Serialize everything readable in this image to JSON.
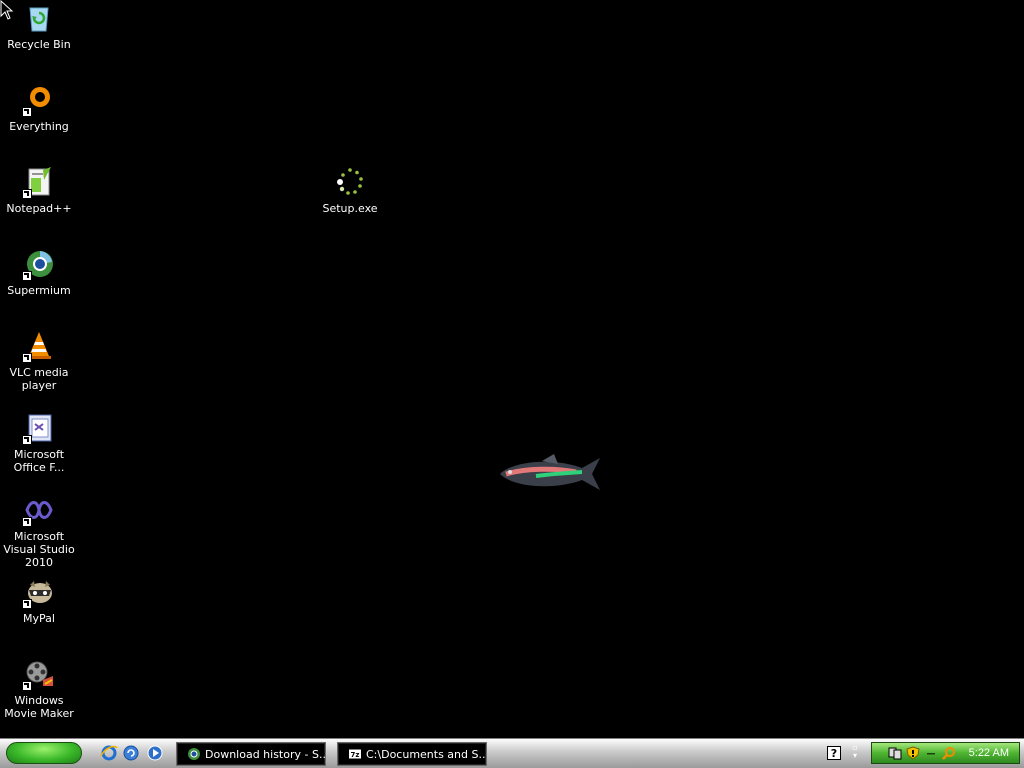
{
  "desktop": {
    "icons": [
      {
        "label": "Recycle Bin",
        "icon": "recycle-bin-icon",
        "shortcut": false
      },
      {
        "label": "Everything",
        "icon": "everything-search-icon",
        "shortcut": true
      },
      {
        "label": "Notepad++",
        "icon": "notepad-plus-plus-icon",
        "shortcut": true
      },
      {
        "label": "Supermium",
        "icon": "supermium-browser-icon",
        "shortcut": true
      },
      {
        "label": "VLC media player",
        "icon": "vlc-cone-icon",
        "shortcut": true
      },
      {
        "label": "Microsoft Office F...",
        "icon": "office-document-icon",
        "shortcut": true
      },
      {
        "label": "Microsoft Visual Studio 2010",
        "icon": "visual-studio-icon",
        "shortcut": true
      },
      {
        "label": "MyPal",
        "icon": "mypal-raccoon-icon",
        "shortcut": true
      },
      {
        "label": "Windows Movie Maker",
        "icon": "movie-maker-icon",
        "shortcut": true
      }
    ],
    "setup": {
      "label": "Setup.exe",
      "icon": "loading-spinner-icon"
    }
  },
  "taskbar": {
    "start_label": "",
    "quick_launch": [
      {
        "name": "internet-explorer-icon"
      },
      {
        "name": "ie-refresh-icon"
      },
      {
        "name": "media-player-icon"
      }
    ],
    "tasks": [
      {
        "label": "Download history - S...",
        "icon": "supermium-taskbar-icon"
      },
      {
        "label": "C:\\Documents and S...",
        "icon": "7zip-icon"
      }
    ],
    "tray": {
      "clock": "5:22 AM",
      "icons": [
        "network-icon",
        "security-shield-icon",
        "minus-icon",
        "search-key-icon"
      ]
    }
  },
  "colors": {
    "desktop_bg": "#000000",
    "tray_green": "#4fb532",
    "start_green": "#3bb82a"
  }
}
